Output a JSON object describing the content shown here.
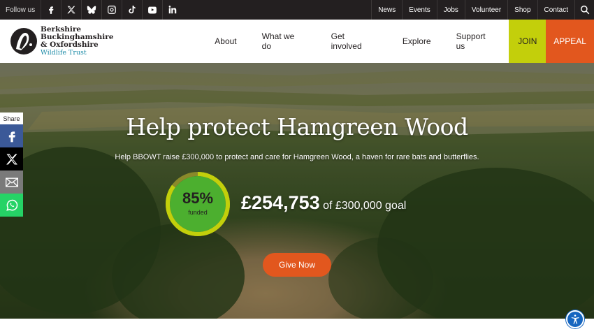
{
  "topbar": {
    "follow_label": "Follow us",
    "social": [
      "facebook-icon",
      "x-icon",
      "bluesky-icon",
      "instagram-icon",
      "tiktok-icon",
      "youtube-icon",
      "linkedin-icon"
    ],
    "links": [
      "News",
      "Events",
      "Jobs",
      "Volunteer",
      "Shop",
      "Contact"
    ]
  },
  "logo": {
    "line1": "Berkshire",
    "line2": "Buckinghamshire",
    "line3": "& Oxfordshire",
    "line4": "Wildlife Trust"
  },
  "nav": {
    "items": [
      "About",
      "What we do",
      "Get involved",
      "Explore",
      "Support us"
    ],
    "join": "JOIN",
    "appeal": "APPEAL"
  },
  "hero": {
    "title": "Help protect Hamgreen Wood",
    "subtitle": "Help BBOWT raise £300,000 to protect and care for Hamgreen Wood, a haven for rare bats and butterflies.",
    "percent_text": "85%",
    "percent_value": 0.85,
    "funded_label": "funded",
    "raised": "£254,753",
    "goal": "of £300,000 goal",
    "cta": "Give Now"
  },
  "share": {
    "label": "Share",
    "buttons": [
      "facebook-icon",
      "x-icon",
      "email-icon",
      "whatsapp-icon"
    ]
  },
  "colors": {
    "topbar": "#231f20",
    "join": "#c3cf0b",
    "appeal": "#e2571e",
    "ring": "#c3cf0b",
    "ring_fill": "#4caf2f",
    "link_teal": "#1a8aa6"
  }
}
